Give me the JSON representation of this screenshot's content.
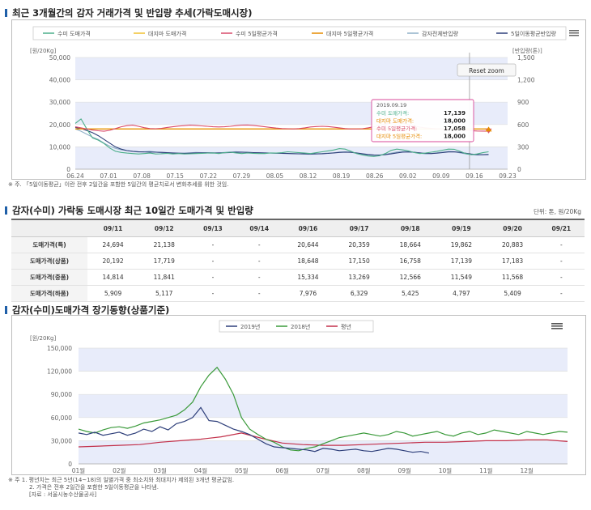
{
  "section1": {
    "title": "최근 3개월간의 감자 거래가격 및 반입량 추세(가락도매시장)",
    "note": "※ 주. 「5일이동평균」이란 전후 2일간을 포함한 5일간의 평균치로서 변화추세를 위한 것임."
  },
  "section2": {
    "title": "감자(수미) 가락동 도매시장 최근 10일간 도매가격 및 반입량",
    "unit": "단위: 톤, 원/20Kg"
  },
  "section3": {
    "title": "감자(수미)도매가격 장기동향(상품기준)",
    "notes": [
      "※ 주 1. 평년치는 최근 5년(14~18)의 일별가격 중 최소치와 최대치가 제외된 3개년 평균값임.",
      "2. 가격은 전후 2일간을 포함한 5일이동평균을 나타냄.",
      "[자료 : 서울시농수산물공사]"
    ]
  },
  "colors": {
    "sumi_price": "#4caf8a",
    "daeji_price": "#f0c030",
    "sumi_ma": "#d94a6a",
    "daeji_ma": "#e68a00",
    "total_volume": "#8fb0c8",
    "volume_ma": "#2e3f7a",
    "y2019": "#2e3f7a",
    "y2018": "#3a9a3a",
    "normal": "#c2304a",
    "band": "#e8ecfa"
  },
  "chart_data": [
    {
      "type": "line",
      "name": "chart1",
      "title": "",
      "ylabel_left": "[원/20Kg]",
      "ylabel_right": "[반입량(톤)]",
      "ylim": [
        0,
        50000
      ],
      "ylim_right": [
        0,
        1500
      ],
      "yticks": [
        "0",
        "10,000",
        "20,000",
        "30,000",
        "40,000",
        "50,000"
      ],
      "yticks_right": [
        "0",
        "300",
        "600",
        "900",
        "1,200",
        "1,500"
      ],
      "categories": [
        "06.24",
        "07.01",
        "07.08",
        "07.15",
        "07.22",
        "07.29",
        "08.05",
        "08.12",
        "08.19",
        "08.26",
        "09.02",
        "09.09",
        "09.16",
        "09.23"
      ],
      "legend_position": "top",
      "reset_label": "Reset zoom",
      "series": [
        {
          "name": "수미 도매가격",
          "key": "sumi_price",
          "axis": "left",
          "values": [
            20500,
            22500,
            18000,
            14000,
            13000,
            11500,
            9500,
            8000,
            7500,
            7200,
            7000,
            6800,
            7000,
            7200,
            6800,
            6900,
            7100,
            6800,
            7000,
            6800,
            6900,
            7000,
            7100,
            7200,
            7300,
            7000,
            7400,
            7600,
            7300,
            7000,
            7300,
            7100,
            7000,
            7000,
            7300,
            7200,
            7400,
            7800,
            7600,
            7400,
            7200,
            7000,
            7400,
            7800,
            8200,
            8600,
            9200,
            9000,
            8000,
            7000,
            6400,
            5900,
            5700,
            6000,
            7000,
            8400,
            9000,
            8700,
            8200,
            7500,
            7000,
            7200,
            7600,
            8000,
            8500,
            9000,
            8900,
            8000,
            7000,
            6500,
            6800,
            7400,
            7800
          ]
        },
        {
          "name": "대지마 도매가격",
          "key": "daeji_price",
          "axis": "left",
          "values": [
            18000,
            18000,
            18000,
            18000,
            18000,
            18000,
            18000,
            18000,
            18000,
            18000,
            18000,
            18000,
            18000,
            18000,
            18000,
            18000,
            18000,
            18000,
            18000,
            18000,
            18000,
            18000,
            18000,
            18000,
            18000,
            18000,
            18000,
            18000,
            18000,
            18000,
            18000,
            18000,
            18000,
            18000,
            18000,
            18000,
            18000,
            18000,
            18000,
            18000,
            18000,
            18000,
            18000,
            18000,
            18000,
            18000,
            18000,
            18000,
            18000,
            18000,
            18000,
            18000,
            18000,
            18000,
            18000,
            18000,
            18000,
            18000,
            18000,
            18000,
            18000,
            18000,
            18000,
            18000,
            18000,
            18000,
            18000,
            18000,
            18000,
            18000,
            18000,
            18000,
            18000
          ]
        },
        {
          "name": "수미 5일평균가격",
          "key": "sumi_ma",
          "axis": "left",
          "values": [
            19000,
            18500,
            18000,
            17500,
            17200,
            17000,
            17400,
            18200,
            19000,
            19500,
            19700,
            19200,
            18600,
            18200,
            18100,
            18300,
            18700,
            19000,
            19300,
            19500,
            19700,
            19600,
            19400,
            19200,
            19000,
            18900,
            19000,
            19200,
            19500,
            19700,
            19800,
            19600,
            19300,
            19000,
            18700,
            18400,
            18200,
            18100,
            18000,
            18200,
            18500,
            18900,
            19100,
            19200,
            19100,
            18800,
            18500,
            18200,
            18000,
            18000,
            18100,
            18500,
            19000,
            19600,
            20200,
            20700,
            20900,
            20600,
            20000,
            19300,
            18800,
            18500,
            18300,
            18100,
            18000,
            17900,
            17800,
            17600,
            17400,
            17200,
            17100,
            17058,
            17000
          ]
        },
        {
          "name": "대지마 5일평균가격",
          "key": "daeji_ma",
          "axis": "left",
          "values": [
            18000,
            18000,
            18000,
            18000,
            18000,
            18000,
            18000,
            18000,
            18000,
            18000,
            18000,
            18000,
            18000,
            18000,
            18000,
            18000,
            18000,
            18000,
            18000,
            18000,
            18000,
            18000,
            18000,
            18000,
            18000,
            18000,
            18000,
            18000,
            18000,
            18000,
            18000,
            18000,
            18000,
            18000,
            18000,
            18000,
            18000,
            18000,
            18000,
            18000,
            18000,
            18000,
            18000,
            18000,
            18000,
            18000,
            18000,
            18000,
            18000,
            18000,
            18000,
            18000,
            18000,
            18000,
            18000,
            18000,
            18000,
            18000,
            18000,
            18000,
            18000,
            18000,
            18000,
            18000,
            18000,
            18000,
            18000,
            18000,
            18000,
            18000,
            18000,
            18000,
            18000
          ]
        },
        {
          "name": "감자전체반입량",
          "key": "total_volume",
          "axis": "right",
          "values": [
            540,
            510,
            470,
            430,
            400,
            350,
            310,
            280,
            260,
            250,
            240,
            230,
            235,
            240,
            230,
            220,
            215,
            210,
            212,
            215,
            220,
            225,
            222,
            218,
            215,
            220,
            225,
            230,
            235,
            230,
            225,
            222,
            220,
            218,
            216,
            214,
            212,
            210,
            208,
            205,
            203,
            200,
            205,
            210,
            215,
            220,
            230,
            235,
            230,
            215,
            200,
            190,
            185,
            190,
            200,
            215,
            230,
            240,
            235,
            225,
            215,
            205,
            210,
            220,
            230,
            240,
            235,
            220,
            205,
            195,
            190,
            195,
            200
          ]
        },
        {
          "name": "5일이동평균반입량",
          "key": "volume_ma",
          "axis": "right",
          "values": [
            560,
            545,
            520,
            490,
            450,
            400,
            350,
            300,
            270,
            250,
            240,
            235,
            232,
            230,
            228,
            226,
            222,
            218,
            215,
            213,
            215,
            218,
            220,
            221,
            220,
            219,
            221,
            224,
            227,
            228,
            226,
            223,
            221,
            219,
            217,
            215,
            213,
            211,
            209,
            207,
            205,
            204,
            205,
            208,
            212,
            218,
            225,
            228,
            226,
            218,
            208,
            198,
            191,
            190,
            195,
            205,
            218,
            228,
            232,
            228,
            220,
            212,
            210,
            215,
            223,
            231,
            233,
            226,
            214,
            203,
            196,
            195,
            197
          ]
        }
      ],
      "tooltip": {
        "date": "2019.09.19",
        "rows": [
          {
            "label": "수미 도매가격",
            "value": "17,139"
          },
          {
            "label": "대지마 도매가격",
            "value": "18,000"
          },
          {
            "label": "수미 5일평균가격",
            "value": "17,058"
          },
          {
            "label": "대지마 5일평균가격",
            "value": "18,000"
          }
        ]
      }
    },
    {
      "type": "table",
      "name": "table1",
      "columns": [
        "",
        "09/11",
        "09/12",
        "09/13",
        "09/14",
        "09/16",
        "09/17",
        "09/18",
        "09/19",
        "09/20",
        "09/21"
      ],
      "rows": [
        {
          "label": "도매가격(특)",
          "values": [
            "24,694",
            "21,138",
            "-",
            "-",
            "20,644",
            "20,359",
            "18,664",
            "19,862",
            "20,883",
            "-"
          ]
        },
        {
          "label": "도매가격(상품)",
          "values": [
            "20,192",
            "17,719",
            "-",
            "-",
            "18,648",
            "17,150",
            "16,758",
            "17,139",
            "17,183",
            "-"
          ]
        },
        {
          "label": "도매가격(중품)",
          "values": [
            "14,814",
            "11,841",
            "-",
            "-",
            "15,334",
            "13,269",
            "12,566",
            "11,549",
            "11,568",
            "-"
          ]
        },
        {
          "label": "도매가격(하품)",
          "values": [
            "5,909",
            "5,117",
            "-",
            "-",
            "7,976",
            "6,329",
            "5,425",
            "4,797",
            "5,409",
            "-"
          ]
        }
      ]
    },
    {
      "type": "line",
      "name": "chart2",
      "title": "",
      "ylabel": "[원/20Kg]",
      "ylim": [
        0,
        150000
      ],
      "yticks": [
        "0",
        "30,000",
        "60,000",
        "90,000",
        "120,000",
        "150,000"
      ],
      "categories": [
        "01월",
        "02월",
        "03월",
        "04월",
        "05월",
        "06월",
        "07월",
        "08월",
        "09월",
        "10월",
        "11월",
        "12월"
      ],
      "legend_position": "top",
      "series": [
        {
          "name": "2019년",
          "key": "y2019",
          "x": [
            1.0,
            1.2,
            1.4,
            1.6,
            1.8,
            2.0,
            2.2,
            2.4,
            2.6,
            2.8,
            3.0,
            3.2,
            3.4,
            3.6,
            3.8,
            4.0,
            4.2,
            4.4,
            4.6,
            4.8,
            5.0,
            5.2,
            5.4,
            5.6,
            5.8,
            6.0,
            6.2,
            6.4,
            6.6,
            6.8,
            7.0,
            7.2,
            7.4,
            7.6,
            7.8,
            8.0,
            8.2,
            8.4,
            8.6,
            8.8,
            9.0,
            9.2,
            9.4,
            9.6
          ],
          "values": [
            40000,
            38000,
            41000,
            37000,
            39000,
            41000,
            37000,
            40000,
            45000,
            42000,
            48000,
            44000,
            52000,
            55000,
            60000,
            73000,
            56000,
            55000,
            50000,
            45000,
            42000,
            38000,
            32000,
            26000,
            22000,
            21000,
            20000,
            19000,
            18000,
            16000,
            20000,
            19000,
            17000,
            18000,
            19000,
            17000,
            16000,
            18000,
            20000,
            19000,
            17000,
            15000,
            16000,
            14000
          ]
        },
        {
          "name": "2018년",
          "key": "y2018",
          "x": [
            1.0,
            1.2,
            1.4,
            1.6,
            1.8,
            2.0,
            2.2,
            2.4,
            2.6,
            2.8,
            3.0,
            3.2,
            3.4,
            3.6,
            3.8,
            4.0,
            4.2,
            4.4,
            4.6,
            4.8,
            5.0,
            5.2,
            5.4,
            5.6,
            5.8,
            6.0,
            6.2,
            6.4,
            6.6,
            6.8,
            7.0,
            7.2,
            7.4,
            7.6,
            7.8,
            8.0,
            8.2,
            8.4,
            8.6,
            8.8,
            9.0,
            9.2,
            9.4,
            9.6,
            9.8,
            10.0,
            10.2,
            10.4,
            10.6,
            10.8,
            11.0,
            11.2,
            11.4,
            11.6,
            11.8,
            12.0,
            12.2,
            12.4,
            12.6,
            12.8,
            13.0
          ],
          "values": [
            45000,
            42000,
            40000,
            44000,
            47000,
            48000,
            46000,
            49000,
            53000,
            55000,
            57000,
            60000,
            63000,
            70000,
            80000,
            100000,
            115000,
            125000,
            110000,
            90000,
            60000,
            45000,
            38000,
            32000,
            28000,
            22000,
            18000,
            17000,
            20000,
            22000,
            26000,
            30000,
            34000,
            36000,
            38000,
            40000,
            38000,
            36000,
            38000,
            42000,
            40000,
            36000,
            38000,
            40000,
            42000,
            38000,
            36000,
            40000,
            42000,
            38000,
            40000,
            44000,
            42000,
            40000,
            38000,
            42000,
            40000,
            38000,
            40000,
            42000,
            41000
          ]
        },
        {
          "name": "평년",
          "key": "normal",
          "x": [
            1.0,
            1.5,
            2.0,
            2.5,
            3.0,
            3.5,
            4.0,
            4.5,
            5.0,
            5.5,
            6.0,
            6.5,
            7.0,
            7.5,
            8.0,
            8.5,
            9.0,
            9.5,
            10.0,
            10.5,
            11.0,
            11.5,
            12.0,
            12.5,
            13.0
          ],
          "values": [
            22000,
            23000,
            24000,
            25000,
            28000,
            30000,
            32000,
            35000,
            40000,
            33000,
            27000,
            25000,
            24000,
            24000,
            25000,
            26000,
            27000,
            28000,
            28000,
            29000,
            30000,
            30000,
            31000,
            31000,
            29000
          ]
        }
      ]
    }
  ]
}
